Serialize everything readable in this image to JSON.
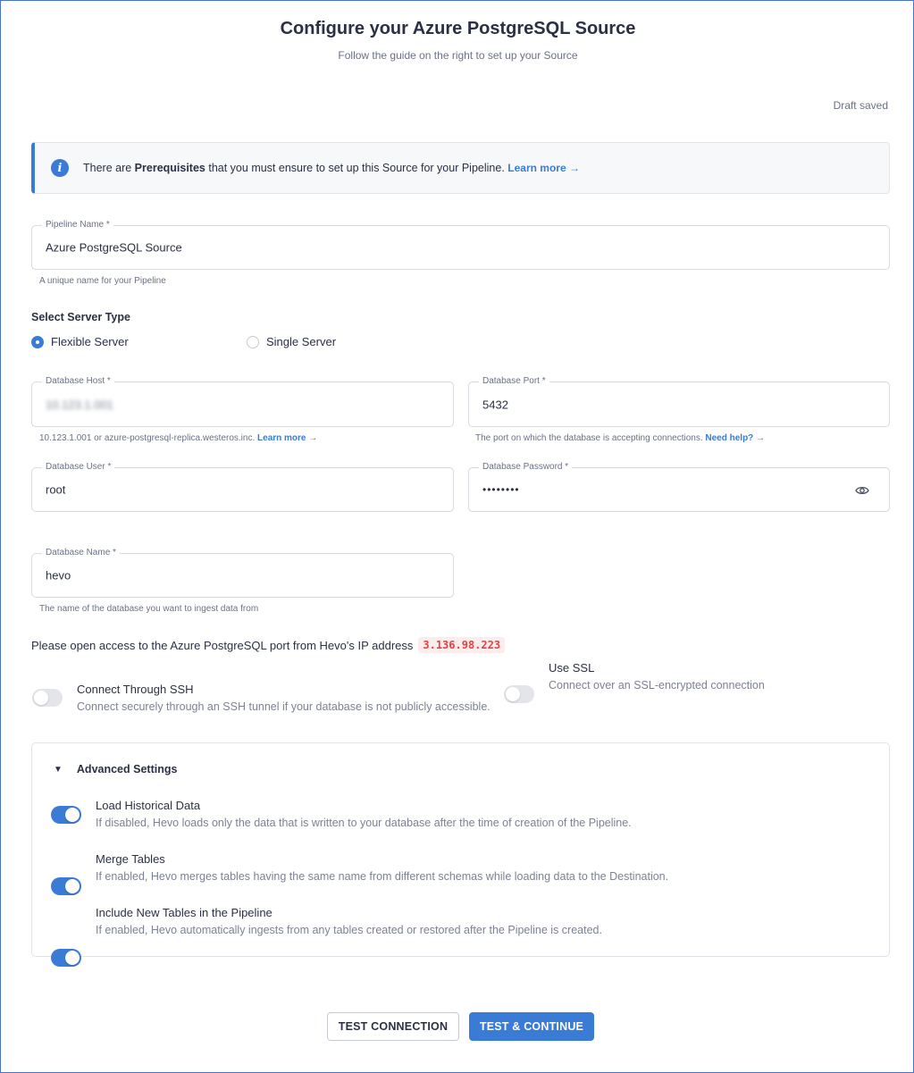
{
  "header": {
    "title": "Configure your Azure PostgreSQL Source",
    "subtitle": "Follow the guide on the right to set up your Source",
    "draft_status": "Draft saved"
  },
  "banner": {
    "text_before": "There are ",
    "text_bold": "Prerequisites",
    "text_after": " that you must ensure to set up this Source for your Pipeline. ",
    "link": "Learn more →"
  },
  "pipeline_name": {
    "label": "Pipeline Name *",
    "value": "Azure PostgreSQL Source",
    "helper": "A unique name for your Pipeline"
  },
  "server_type": {
    "title": "Select Server Type",
    "options": [
      {
        "label": "Flexible Server",
        "selected": true
      },
      {
        "label": "Single Server",
        "selected": false
      }
    ]
  },
  "db_host": {
    "label": "Database Host *",
    "value": "10.123.1.001",
    "helper": "10.123.1.001 or azure-postgresql-replica.westeros.inc. ",
    "helper_link": "Learn more →"
  },
  "db_port": {
    "label": "Database Port *",
    "value": "5432",
    "helper": "The port on which the database is accepting connections. ",
    "helper_link": "Need help? →"
  },
  "db_user": {
    "label": "Database User *",
    "value": "root"
  },
  "db_password": {
    "label": "Database Password *",
    "value": "••••••••"
  },
  "db_name": {
    "label": "Database Name *",
    "value": "hevo",
    "helper": "The name of the database you want to ingest data from"
  },
  "ip_notice": {
    "text": "Please open access to the Azure PostgreSQL port from Hevo's IP address",
    "ip": "3.136.98.223"
  },
  "ssh": {
    "title": "Connect Through SSH",
    "description": "Connect securely through an SSH tunnel if your database is not publicly accessible.",
    "enabled": false
  },
  "ssl": {
    "title": "Use SSL",
    "description": "Connect over an SSL-encrypted connection",
    "enabled": false
  },
  "advanced": {
    "title": "Advanced Settings",
    "settings": [
      {
        "title": "Load Historical Data",
        "description": "If disabled, Hevo loads only the data that is written to your database after the time of creation of the Pipeline.",
        "enabled": true
      },
      {
        "title": "Merge Tables",
        "description": "If enabled, Hevo merges tables having the same name from different schemas while loading data to the Destination.",
        "enabled": true
      },
      {
        "title": "Include New Tables in the Pipeline",
        "description": "If enabled, Hevo automatically ingests from any tables created or restored after the Pipeline is created.",
        "enabled": true
      }
    ]
  },
  "actions": {
    "test_connection": "TEST CONNECTION",
    "test_continue": "TEST & CONTINUE"
  },
  "colors": {
    "accent": "#3a7bd5",
    "ip_text": "#e04444",
    "ip_bg": "#fdecec"
  }
}
